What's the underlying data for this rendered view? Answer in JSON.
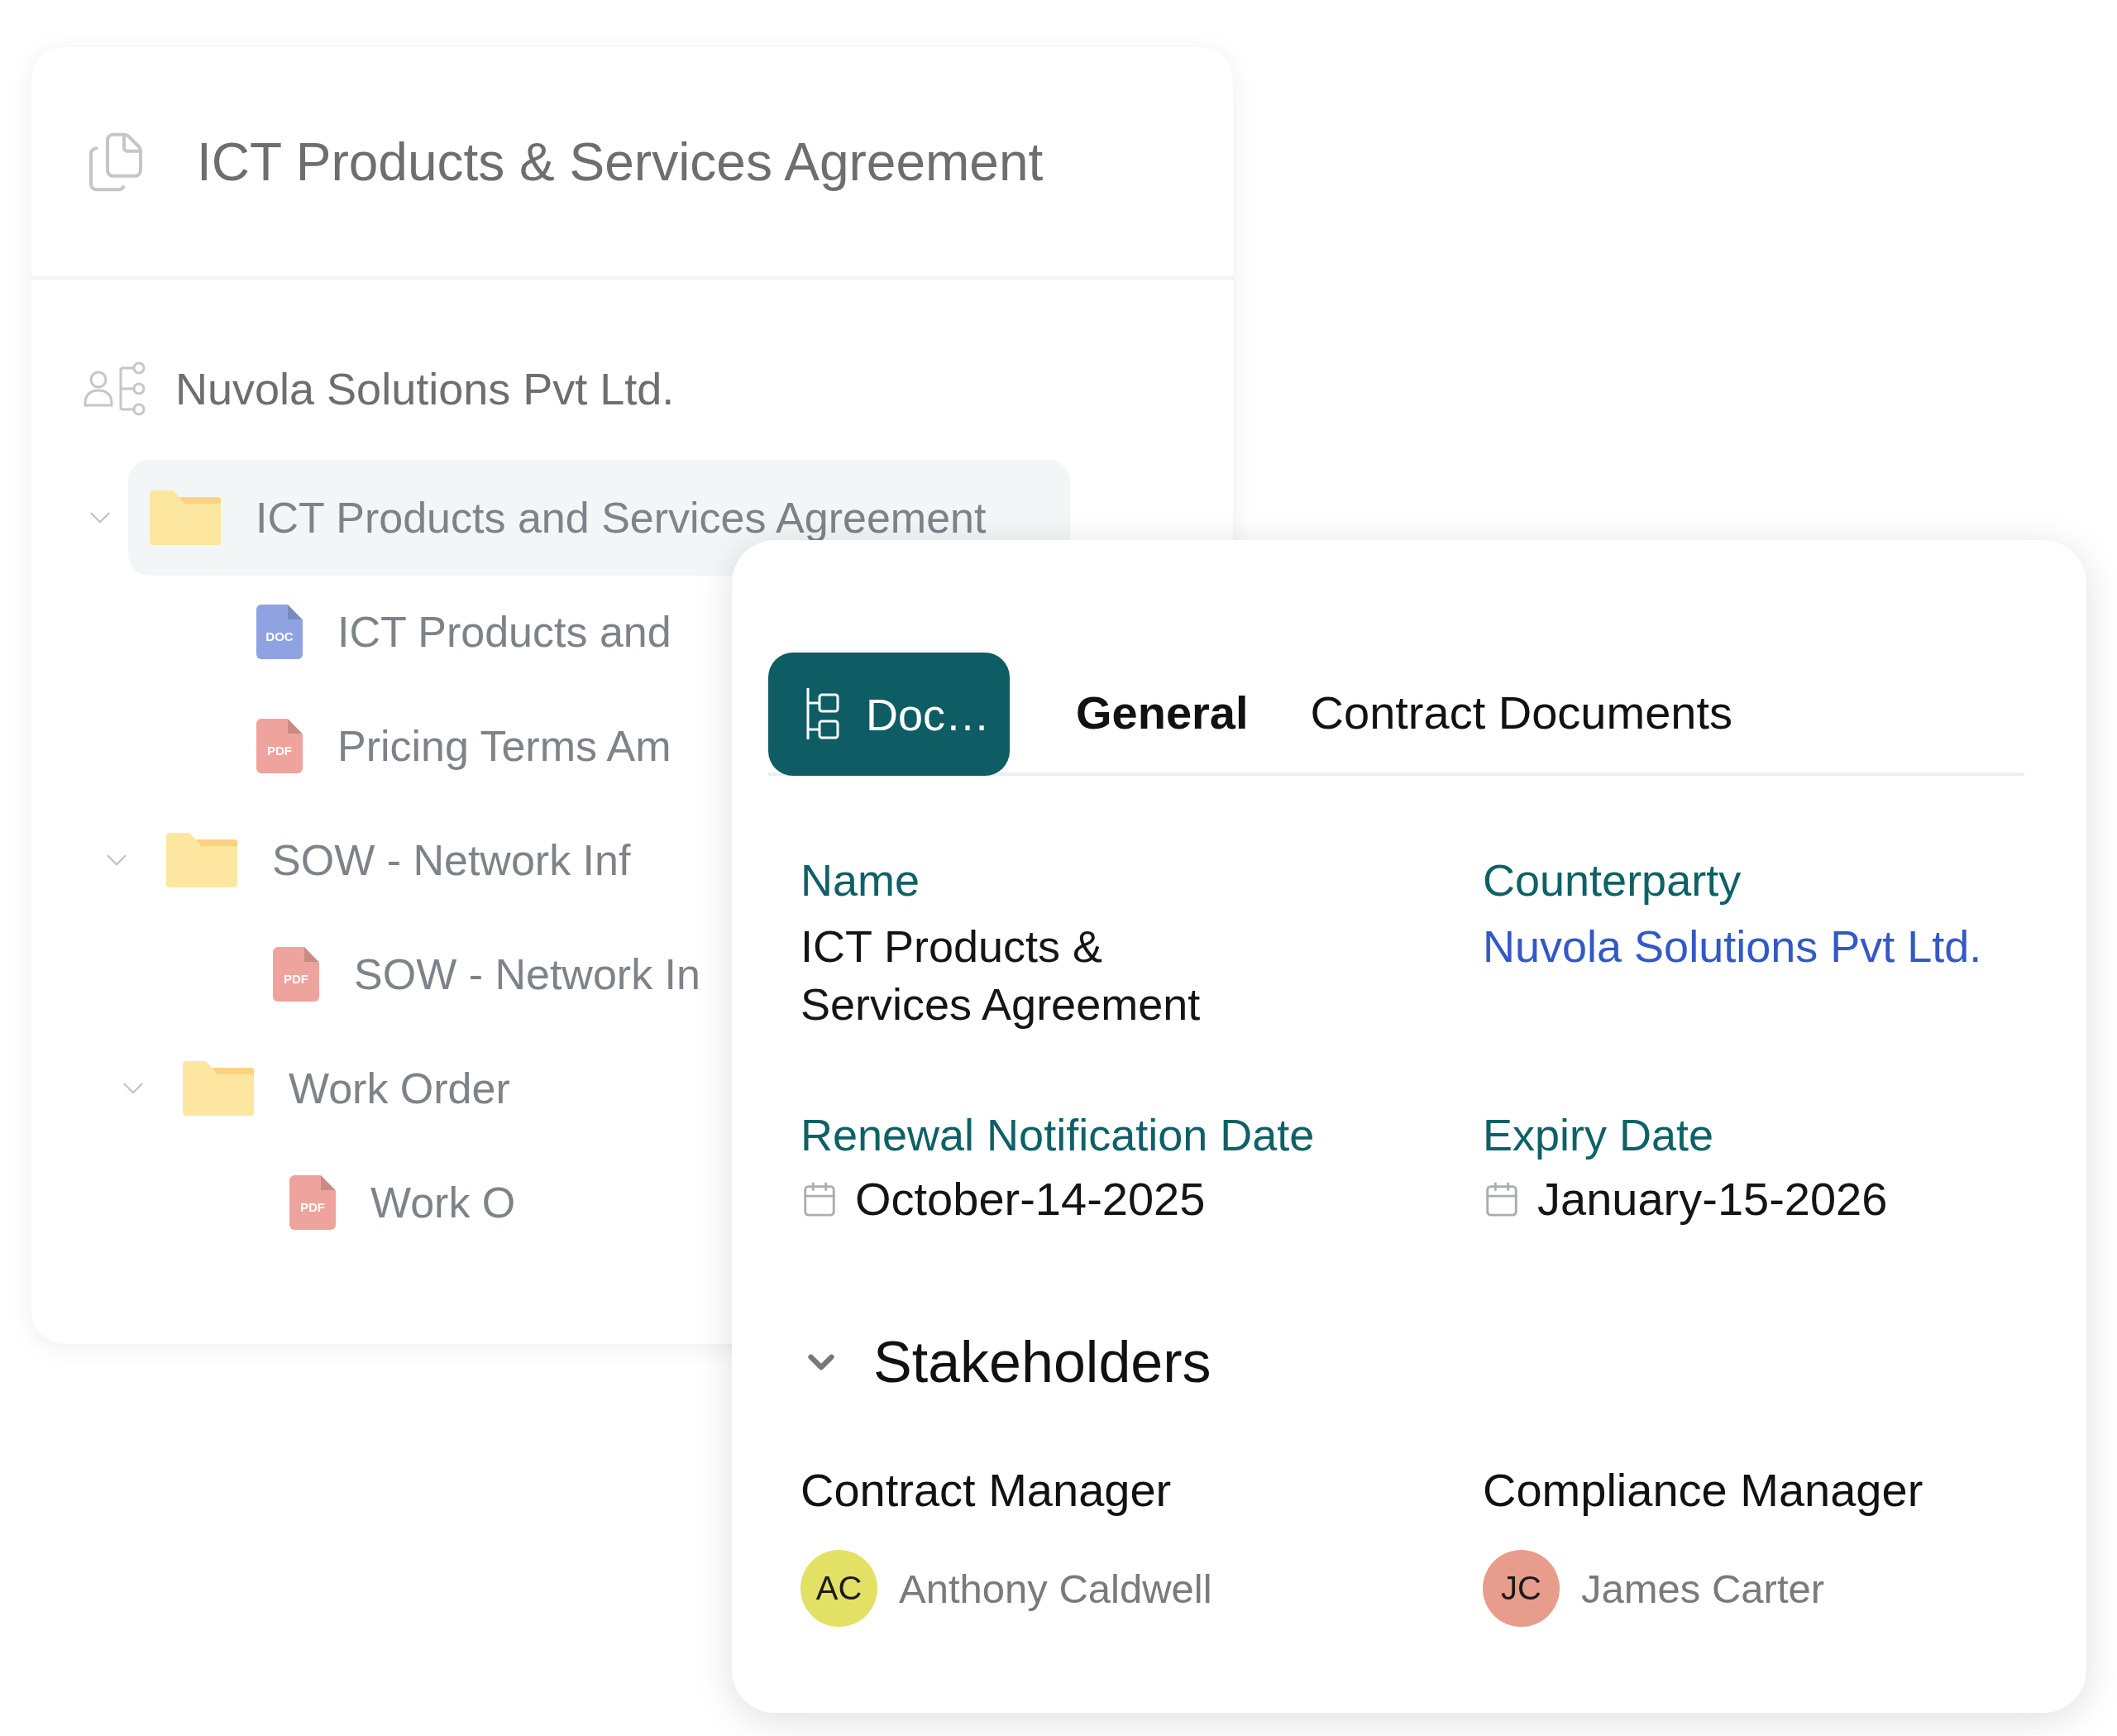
{
  "document_panel": {
    "title": "ICT Products & Services Agreement",
    "counterparty": "Nuvola Solutions Pvt Ltd.",
    "tree": [
      {
        "kind": "folder",
        "label": "ICT Products and Services Agreement",
        "expanded": true,
        "selected": true,
        "children": [
          {
            "kind": "doc",
            "badge": "DOC",
            "label": "ICT Products and",
            "selected": false
          },
          {
            "kind": "pdf",
            "badge": "PDF",
            "label": "Pricing Terms Am",
            "selected": false
          },
          {
            "kind": "folder",
            "label": "SOW - Network Inf",
            "expanded": true,
            "selected": false,
            "children": [
              {
                "kind": "pdf",
                "badge": "PDF",
                "label": "SOW - Network In",
                "selected": false
              },
              {
                "kind": "folder",
                "label": "Work Order",
                "expanded": true,
                "selected": false,
                "children": [
                  {
                    "kind": "pdf",
                    "badge": "PDF",
                    "label": "Work O",
                    "selected": false
                  }
                ]
              }
            ]
          }
        ]
      }
    ]
  },
  "details_panel": {
    "doc_button": {
      "label": "Doc…"
    },
    "tabs": [
      {
        "label": "General",
        "selected": true
      },
      {
        "label": "Contract Documents",
        "selected": false
      }
    ],
    "fields": [
      {
        "kind": "text",
        "label": "Name",
        "value": "ICT Products & Services Agreement"
      },
      {
        "kind": "link",
        "label": "Counterparty",
        "value": "Nuvola Solutions Pvt Ltd."
      },
      {
        "kind": "date",
        "label": "Renewal Notification Date",
        "value": "October-14-2025"
      },
      {
        "kind": "date",
        "label": "Expiry Date",
        "value": "January-15-2026"
      }
    ],
    "stakeholders": {
      "title": "Stakeholders",
      "expanded": true,
      "people": [
        {
          "role": "Contract Manager",
          "initials": "AC",
          "name": "Anthony Caldwell",
          "color": "#e3e066"
        },
        {
          "role": "Compliance Manager",
          "initials": "JC",
          "name": "James Carter",
          "color": "#e89c8c"
        }
      ]
    }
  }
}
